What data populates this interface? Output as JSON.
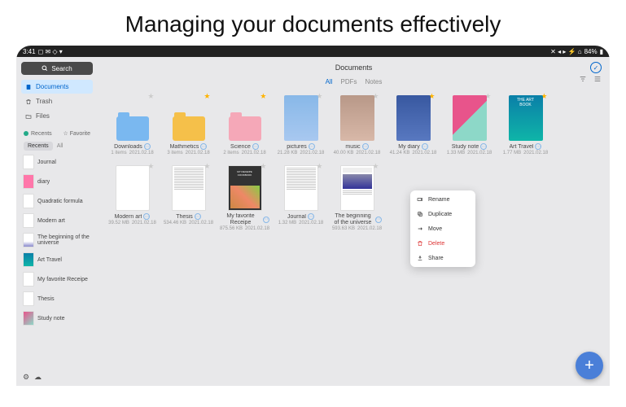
{
  "hero": "Managing your documents effectively",
  "status": {
    "time": "3:41",
    "battery": "84%"
  },
  "search": {
    "label": "Search"
  },
  "nav": {
    "documents": "Documents",
    "trash": "Trash",
    "files": "Files"
  },
  "recents": {
    "label": "Recents",
    "favorite": "Favorite",
    "tabs": {
      "recents": "Recents",
      "all": "All"
    },
    "items": [
      {
        "name": "Journal"
      },
      {
        "name": "diary"
      },
      {
        "name": "Quadratic formula"
      },
      {
        "name": "Modern art"
      },
      {
        "name": "The beginning of the universe"
      },
      {
        "name": "Art Travel"
      },
      {
        "name": "My favorite Receipe"
      },
      {
        "name": "Thesis"
      },
      {
        "name": "Study note"
      }
    ]
  },
  "header": {
    "title": "Documents"
  },
  "filters": {
    "all": "All",
    "pdfs": "PDFs",
    "notes": "Notes"
  },
  "docs": [
    {
      "name": "Downloads",
      "meta1": "1 items",
      "meta2": "2021.02.18",
      "starred": false,
      "type": "folder-blue"
    },
    {
      "name": "Mathmetics",
      "meta1": "3 items",
      "meta2": "2021.02.18",
      "starred": true,
      "type": "folder-yellow"
    },
    {
      "name": "Science",
      "meta1": "2 items",
      "meta2": "2021.02.18",
      "starred": true,
      "type": "folder-pink"
    },
    {
      "name": "pictures",
      "meta1": "21.28 KB",
      "meta2": "2021.02.18",
      "starred": false,
      "type": "book-pictures"
    },
    {
      "name": "music",
      "meta1": "40.00 KB",
      "meta2": "2021.02.18",
      "starred": false,
      "type": "book-music"
    },
    {
      "name": "My diary",
      "meta1": "41.24 KB",
      "meta2": "2021.02.18",
      "starred": true,
      "type": "book-diary"
    },
    {
      "name": "Study note",
      "meta1": "1.33 MB",
      "meta2": "2021.02.18",
      "starred": false,
      "type": "book-study"
    },
    {
      "name": "Art Travel",
      "meta1": "1.77 MB",
      "meta2": "2021.02.18",
      "starred": true,
      "type": "book-art",
      "artTitle": "THE ART BOOK"
    },
    {
      "name": "Modern art",
      "meta1": "39.52 MB",
      "meta2": "2021.02.18",
      "starred": false,
      "type": "book-modern"
    },
    {
      "name": "Thesis",
      "meta1": "534.46 KB",
      "meta2": "2021.02.18",
      "starred": false,
      "type": "page"
    },
    {
      "name": "My favorite Receipe",
      "meta1": "875.56 KB",
      "meta2": "2021.02.18",
      "starred": false,
      "type": "recipe",
      "recipeTitle": "MY RECEIPE COOKBOOK"
    },
    {
      "name": "Journal",
      "meta1": "1.32 MB",
      "meta2": "2021.02.18",
      "starred": false,
      "type": "page"
    },
    {
      "name": "The beginning of the universe",
      "meta1": "593.63 KB",
      "meta2": "2021.02.18",
      "starred": false,
      "type": "page-img"
    }
  ],
  "context": {
    "rename": "Rename",
    "duplicate": "Duplicate",
    "move": "Move",
    "delete": "Delete",
    "share": "Share"
  }
}
